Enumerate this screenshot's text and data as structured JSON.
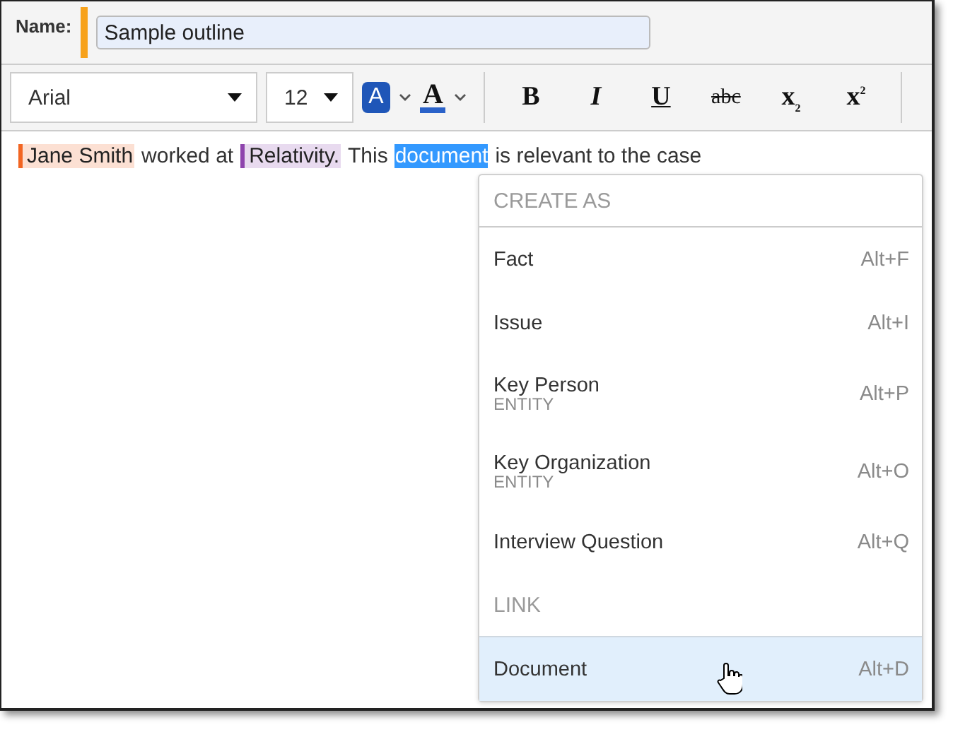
{
  "name_field": {
    "label": "Name:",
    "value": "Sample outline"
  },
  "toolbar": {
    "font": "Arial",
    "size": "12",
    "highlight_glyph": "A",
    "color_glyph": "A",
    "format_buttons": [
      {
        "kind": "bold",
        "glyph": "B"
      },
      {
        "kind": "italic",
        "glyph": "I"
      },
      {
        "kind": "underline",
        "glyph": "U"
      },
      {
        "kind": "strike",
        "glyph": "abc"
      },
      {
        "kind": "subscript",
        "glyph": "x",
        "mark": "2"
      },
      {
        "kind": "superscript",
        "glyph": "x",
        "mark": "2"
      }
    ]
  },
  "editor": {
    "segments": [
      {
        "kind": "tag",
        "text": "Jane Smith",
        "color": "#f26522"
      },
      {
        "kind": "plain",
        "text": "worked at"
      },
      {
        "kind": "tag",
        "text": "Relativity.",
        "color": "#8e44ad"
      },
      {
        "kind": "plain",
        "text": "This"
      },
      {
        "kind": "selection",
        "text": "document"
      },
      {
        "kind": "plain",
        "text": "is relevant to the case"
      }
    ]
  },
  "menu": {
    "items": [
      {
        "kind": "header",
        "label": "CREATE AS"
      },
      {
        "kind": "item",
        "label": "Fact",
        "shortcut": "Alt+F",
        "selected": false
      },
      {
        "kind": "item",
        "label": "Issue",
        "shortcut": "Alt+I",
        "selected": false
      },
      {
        "kind": "item",
        "label": "Key Person",
        "sublabel": "ENTITY",
        "shortcut": "Alt+P",
        "selected": false
      },
      {
        "kind": "item",
        "label": "Key Organization",
        "sublabel": "ENTITY",
        "shortcut": "Alt+O",
        "selected": false
      },
      {
        "kind": "item",
        "label": "Interview Question",
        "shortcut": "Alt+Q",
        "selected": false
      },
      {
        "kind": "header",
        "label": "LINK"
      },
      {
        "kind": "item",
        "label": "Document",
        "shortcut": "Alt+D",
        "selected": true
      }
    ]
  }
}
